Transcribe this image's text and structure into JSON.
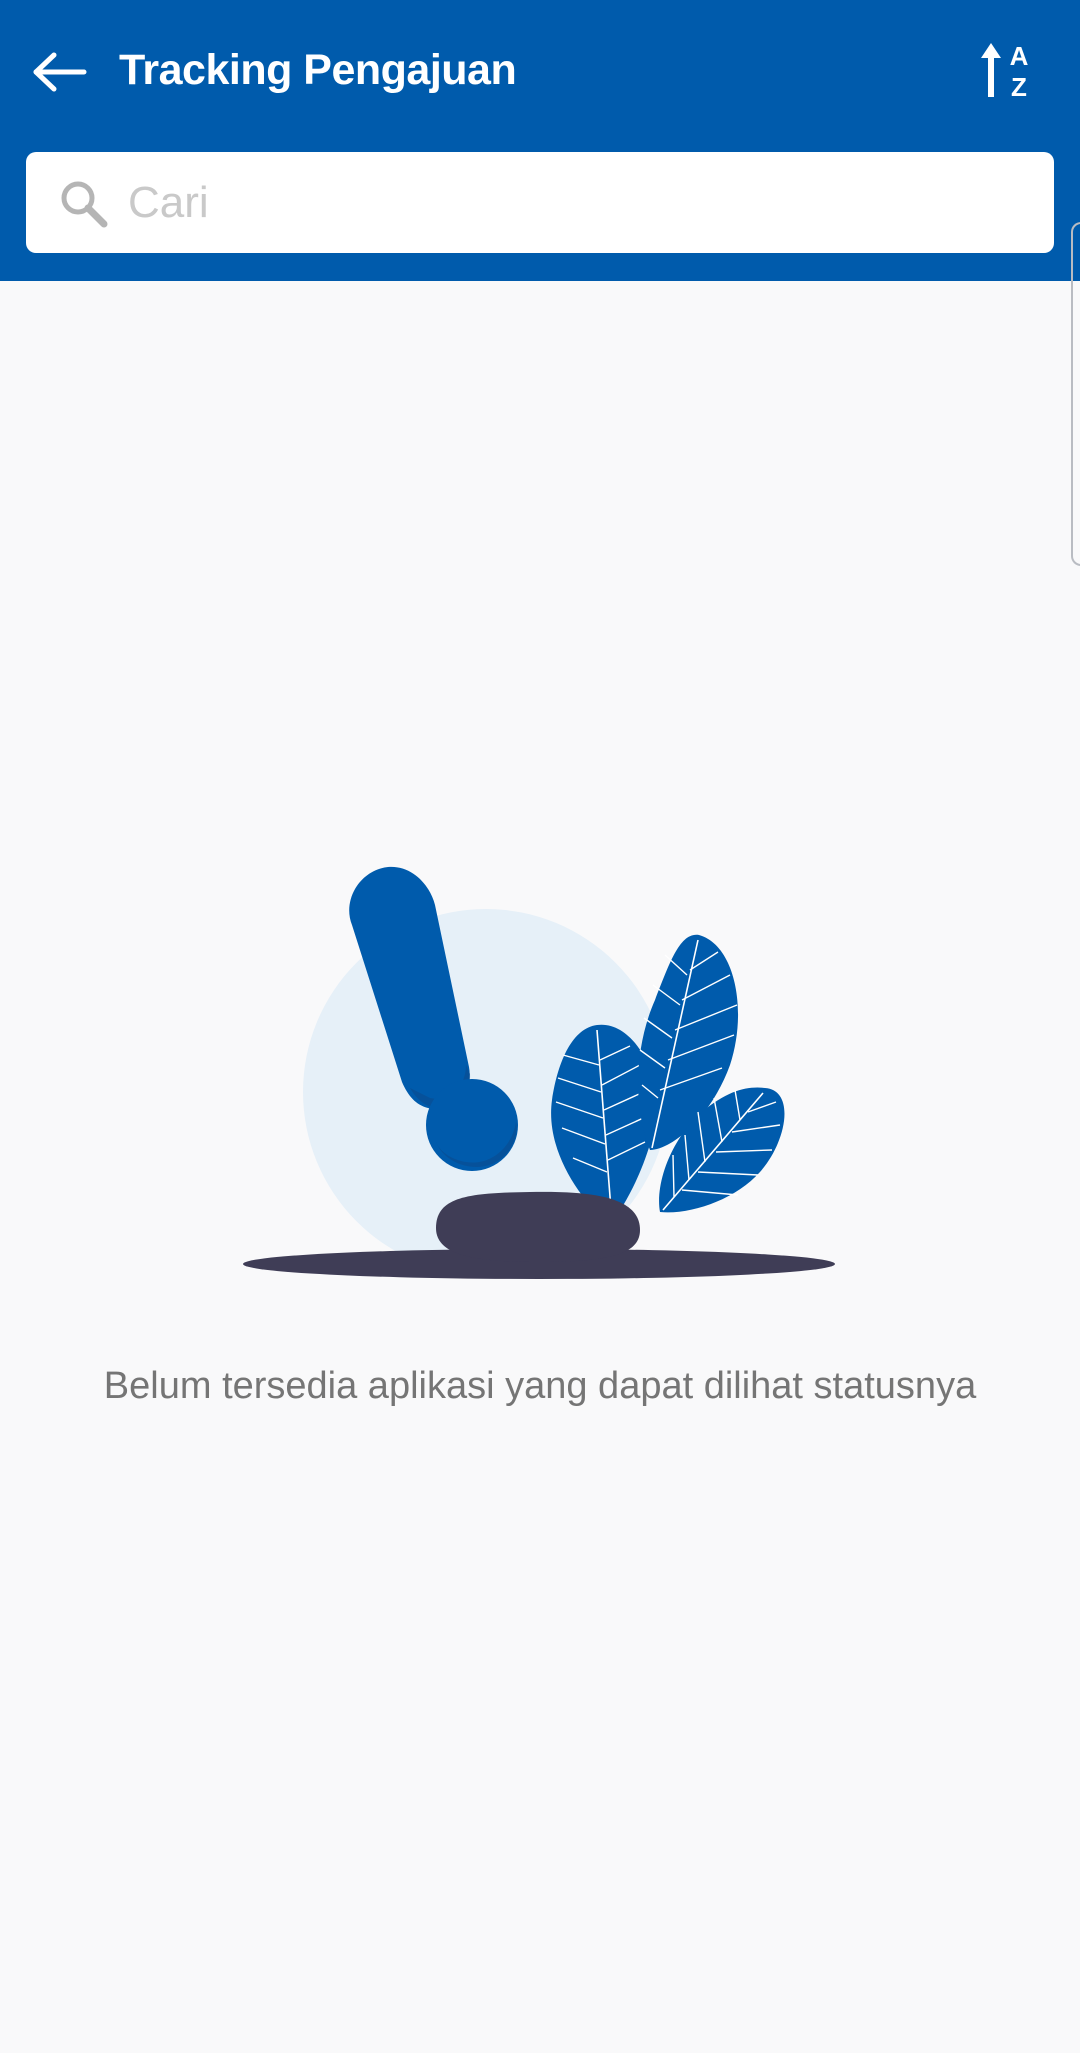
{
  "header": {
    "title": "Tracking Pengajuan",
    "back_icon": "arrow-left-icon",
    "sort_icon": "sort-alpha-asc-icon",
    "sort_letters": [
      "A",
      "Z"
    ]
  },
  "search": {
    "placeholder": "Cari",
    "value": "",
    "icon": "search-icon"
  },
  "empty_state": {
    "illustration": "empty-exclamation-leaves-illustration",
    "message": "Belum tersedia aplikasi yang dapat dilihat statusnya"
  },
  "colors": {
    "primary": "#005bac",
    "background": "#f9f9fa",
    "circle_bg": "#e6f0f8",
    "ground": "#3f3d56",
    "text_muted": "#757575",
    "placeholder": "#c9c9c9"
  }
}
